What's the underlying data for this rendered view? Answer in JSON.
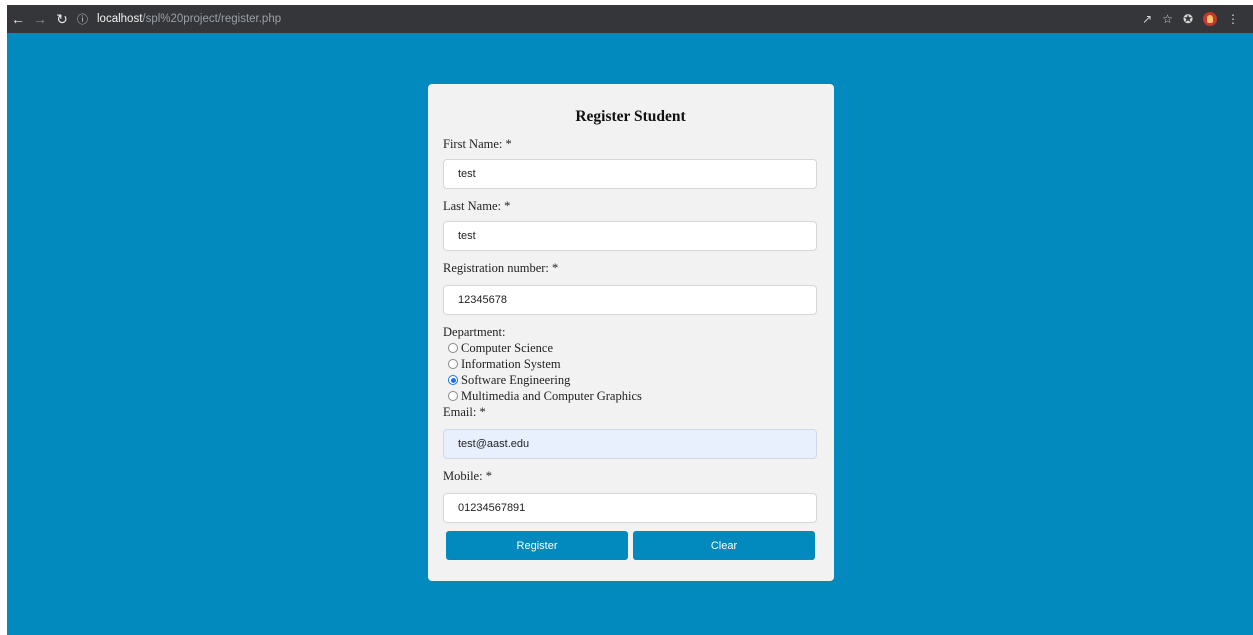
{
  "browser": {
    "url_host": "localhost",
    "url_path": "/spl%20project/register.php",
    "icons": [
      "back-icon",
      "forward-icon",
      "reload-icon",
      "info-icon",
      "share-icon",
      "star-icon",
      "extensions-icon",
      "profile-icon",
      "menu-icon"
    ]
  },
  "form": {
    "title": "Register Student",
    "first_name": {
      "label": "First Name: *",
      "value": "test"
    },
    "last_name": {
      "label": "Last Name: *",
      "value": "test"
    },
    "registration": {
      "label": "Registration number: *",
      "value": "12345678"
    },
    "department": {
      "label": "Department:",
      "options": [
        {
          "label": "Computer Science",
          "checked": false
        },
        {
          "label": "Information System",
          "checked": false
        },
        {
          "label": "Software Engineering",
          "checked": true
        },
        {
          "label": "Multimedia and Computer Graphics",
          "checked": false
        }
      ]
    },
    "email": {
      "label": "Email: *",
      "value": "test@aast.edu"
    },
    "mobile": {
      "label": "Mobile: *",
      "value": "01234567891"
    },
    "register_label": "Register",
    "clear_label": "Clear"
  },
  "colors": {
    "page_background": "#0289bd",
    "card_background": "#f2f2f2",
    "button": "#0289bd",
    "autofill": "#e8f0fe"
  }
}
